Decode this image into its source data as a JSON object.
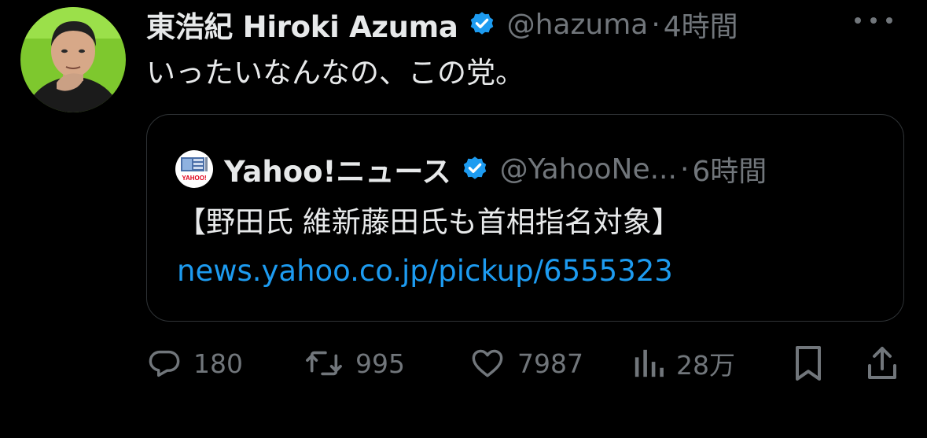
{
  "tweet": {
    "author_name": "東浩紀 Hiroki Azuma",
    "handle": "@hazuma",
    "separator": "·",
    "time": "4時間",
    "text": "いったいなんなの、この党。"
  },
  "quote": {
    "author_name": "Yahoo!ニュース",
    "handle": "@YahooNe...",
    "separator": "·",
    "time": "6時間",
    "text": "【野田氏 維新藤田氏も首相指名対象】",
    "link": "news.yahoo.co.jp/pickup/6555323",
    "avatar_logo_text": "YAHOO!"
  },
  "actions": {
    "replies": "180",
    "retweets": "995",
    "likes": "7987",
    "views": "28万"
  },
  "icons": {
    "verified": "verified-badge-icon",
    "more": "more-options-icon",
    "reply": "reply-icon",
    "retweet": "retweet-icon",
    "like": "heart-icon",
    "views": "views-chart-icon",
    "bookmark": "bookmark-icon",
    "share": "share-icon"
  },
  "colors": {
    "background": "#000000",
    "text": "#e7e9ea",
    "muted": "#71767b",
    "link": "#1d9bf0",
    "verified": "#1d9bf0",
    "border": "#2f3336"
  }
}
